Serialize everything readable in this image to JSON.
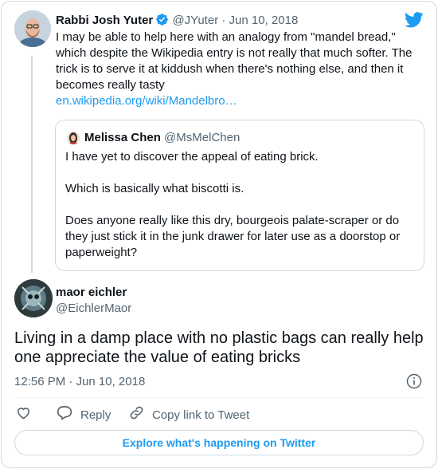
{
  "tweet": {
    "author_name": "Rabbi Josh Yuter",
    "author_handle": "@JYuter",
    "separator": "·",
    "date": "Jun 10, 2018",
    "text": "I may be able to help here with an analogy from \"mandel bread,\" which despite the Wikipedia entry is not really that much softer. The trick is to serve it at kiddush when there's nothing else, and then it becomes really tasty",
    "link": "en.wikipedia.org/wiki/Mandelbro…"
  },
  "quoted": {
    "author_name": "Melissa Chen",
    "author_handle": "@MsMelChen",
    "paragraphs": [
      "I have yet to discover the appeal of eating brick.",
      "Which is basically what biscotti is.",
      "Does anyone really like this dry, bourgeois palate-scraper or do they just stick it in the junk drawer for later use as a doorstop or paperweight?"
    ]
  },
  "reply": {
    "author_name": "maor eichler",
    "author_handle": "@EichlerMaor",
    "text": "Living in a damp place with no plastic bags can really help one appreciate the value of eating bricks",
    "time": "12:56 PM",
    "separator": "·",
    "date": "Jun 10, 2018"
  },
  "actions": {
    "reply_label": "Reply",
    "copy_label": "Copy link to Tweet"
  },
  "explore_label": "Explore what's happening on Twitter",
  "colors": {
    "accent": "#1d9bf0",
    "muted": "#536471",
    "border": "#cfd9de"
  },
  "icons": [
    "verified-badge-icon",
    "twitter-bird-icon",
    "info-icon",
    "heart-icon",
    "reply-icon",
    "link-icon"
  ]
}
